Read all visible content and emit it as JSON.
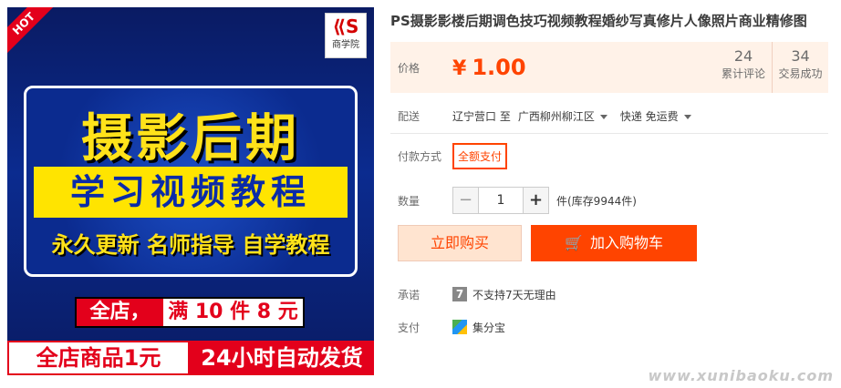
{
  "hero": {
    "hot_tag": "HOT",
    "logo_text": "商学院",
    "main_title": "摄影后期",
    "subtitle": "学习视频教程",
    "tagline": "永久更新 名师指导 自学教程",
    "promo_store": "全店，",
    "promo_offer": "满 10 件 8 元",
    "promo_all": "全店商品1元",
    "promo_ship": "24小时自动发货"
  },
  "product": {
    "title": "PS摄影影楼后期调色技巧视频教程婚纱写真修片人像照片商业精修图",
    "price_label": "价格",
    "currency": "¥",
    "price": "1.00",
    "stats": [
      {
        "num": "24",
        "label": "累计评论"
      },
      {
        "num": "34",
        "label": "交易成功"
      }
    ],
    "shipping": {
      "label": "配送",
      "from": "辽宁营口 至",
      "to": "广西柳州柳江区",
      "method": "快递 免运费"
    },
    "payment_method": {
      "label": "付款方式",
      "option": "全额支付"
    },
    "quantity": {
      "label": "数量",
      "value": "1",
      "minus": "−",
      "plus": "+",
      "stock": "件(库存9944件)"
    },
    "buttons": {
      "buy_now": "立即购买",
      "add_cart": "加入购物车"
    },
    "promise": {
      "label": "承诺",
      "icon": "7",
      "text": "不支持7天无理由"
    },
    "pay": {
      "label": "支付",
      "text": "集分宝"
    }
  },
  "watermark": "www.xunibaoku.com"
}
